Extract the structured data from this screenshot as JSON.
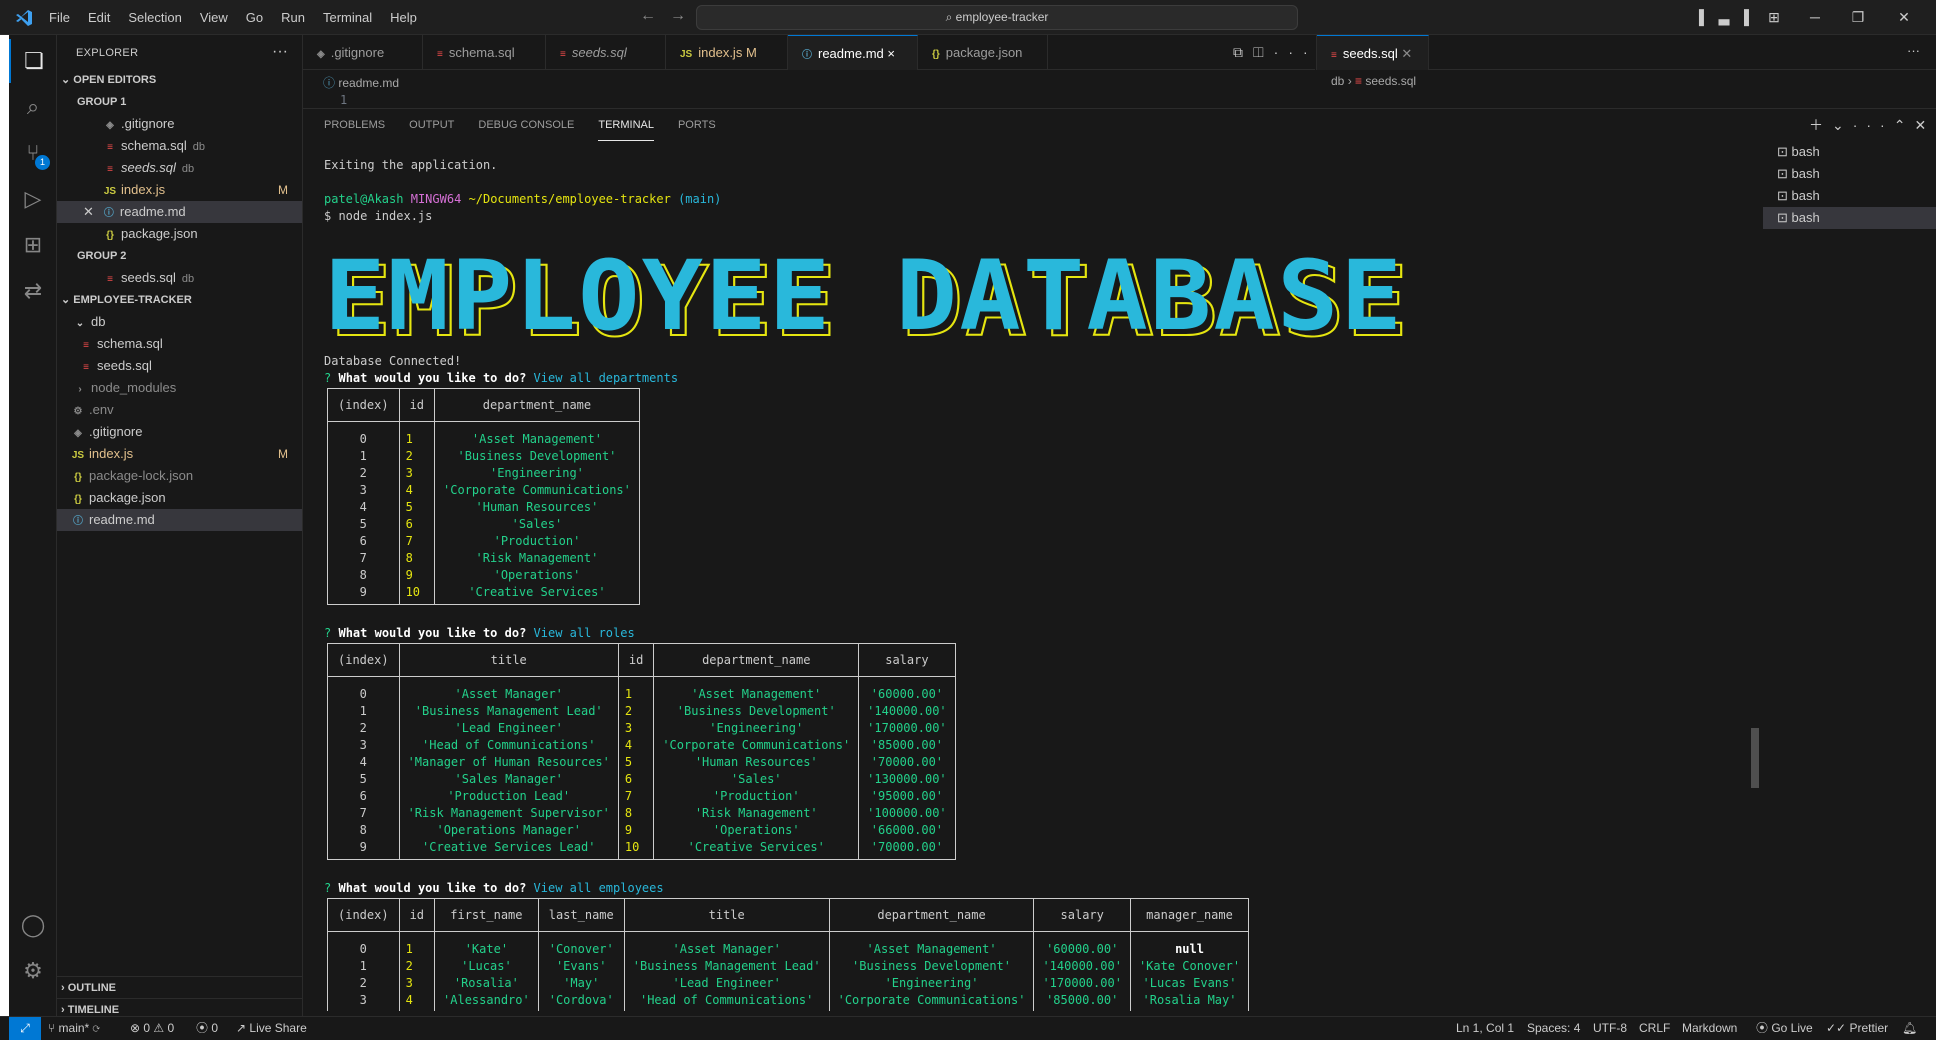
{
  "titlebar": {
    "menu": [
      "File",
      "Edit",
      "Selection",
      "View",
      "Go",
      "Run",
      "Terminal",
      "Help"
    ],
    "search": "employee-tracker"
  },
  "sidebar": {
    "title": "EXPLORER",
    "open_editors_label": "OPEN EDITORS",
    "group1_label": "GROUP 1",
    "group2_label": "GROUP 2",
    "group1": [
      {
        "icon": "git",
        "name": ".gitignore",
        "desc": "",
        "status": ""
      },
      {
        "icon": "sql",
        "name": "schema.sql",
        "desc": "db",
        "status": ""
      },
      {
        "icon": "sql",
        "name": "seeds.sql",
        "desc": "db",
        "status": ""
      },
      {
        "icon": "js",
        "name": "index.js",
        "desc": "",
        "status": "M"
      },
      {
        "icon": "info",
        "name": "readme.md",
        "desc": "",
        "status": ""
      },
      {
        "icon": "json",
        "name": "package.json",
        "desc": "",
        "status": ""
      }
    ],
    "group2": [
      {
        "icon": "sql",
        "name": "seeds.sql",
        "desc": "db"
      }
    ],
    "project_label": "EMPLOYEE-TRACKER",
    "tree": [
      {
        "icon": "folder",
        "name": "db",
        "status": ""
      },
      {
        "icon": "sql",
        "name": "schema.sql",
        "status": ""
      },
      {
        "icon": "sql",
        "name": "seeds.sql",
        "status": ""
      },
      {
        "icon": "folder-closed",
        "name": "node_modules",
        "status": ""
      },
      {
        "icon": "env",
        "name": ".env",
        "status": ""
      },
      {
        "icon": "git",
        "name": ".gitignore",
        "status": ""
      },
      {
        "icon": "js",
        "name": "index.js",
        "status": "M"
      },
      {
        "icon": "json",
        "name": "package-lock.json",
        "status": ""
      },
      {
        "icon": "json",
        "name": "package.json",
        "status": ""
      },
      {
        "icon": "info",
        "name": "readme.md",
        "status": ""
      }
    ],
    "outline_label": "OUTLINE",
    "timeline_label": "TIMELINE"
  },
  "tabs": [
    {
      "icon": "git",
      "label": ".gitignore",
      "italic": false,
      "status": ""
    },
    {
      "icon": "sql",
      "label": "schema.sql",
      "italic": false,
      "status": ""
    },
    {
      "icon": "sql",
      "label": "seeds.sql",
      "italic": true,
      "status": ""
    },
    {
      "icon": "js",
      "label": "index.js",
      "italic": false,
      "status": "M"
    },
    {
      "icon": "info",
      "label": "readme.md",
      "italic": false,
      "status": "×"
    },
    {
      "icon": "json",
      "label": "package.json",
      "italic": false,
      "status": ""
    }
  ],
  "editor": {
    "breadcrumb": "readme.md",
    "line1": "1"
  },
  "editor2": {
    "tab": "seeds.sql",
    "breadcrumb_folder": "db",
    "breadcrumb_file": "seeds.sql"
  },
  "panel": {
    "tabs": [
      "PROBLEMS",
      "OUTPUT",
      "DEBUG CONSOLE",
      "TERMINAL",
      "PORTS"
    ],
    "active_tab": "TERMINAL",
    "terminals": [
      "bash",
      "bash",
      "bash",
      "bash"
    ]
  },
  "terminal": {
    "exit_line": "Exiting the application.",
    "prompt_user": "patel@Akash",
    "prompt_env": "MINGW64",
    "prompt_path": "~/Documents/employee-tracker",
    "prompt_branch": "(main)",
    "command": "$ node index.js",
    "banner": "EMPLOYEE DATABASE",
    "connected": "Database Connected!",
    "q_mark": "?",
    "question": "What would you like to do?",
    "answer1": "View all departments",
    "answer2": "View all roles",
    "answer3": "View all employees",
    "departments": {
      "headers": [
        "(index)",
        "id",
        "department_name"
      ],
      "rows": [
        [
          "0",
          "1",
          "'Asset Management'"
        ],
        [
          "1",
          "2",
          "'Business Development'"
        ],
        [
          "2",
          "3",
          "'Engineering'"
        ],
        [
          "3",
          "4",
          "'Corporate Communications'"
        ],
        [
          "4",
          "5",
          "'Human Resources'"
        ],
        [
          "5",
          "6",
          "'Sales'"
        ],
        [
          "6",
          "7",
          "'Production'"
        ],
        [
          "7",
          "8",
          "'Risk Management'"
        ],
        [
          "8",
          "9",
          "'Operations'"
        ],
        [
          "9",
          "10",
          "'Creative Services'"
        ]
      ]
    },
    "roles": {
      "headers": [
        "(index)",
        "title",
        "id",
        "department_name",
        "salary"
      ],
      "rows": [
        [
          "0",
          "'Asset Manager'",
          "1",
          "'Asset Management'",
          "'60000.00'"
        ],
        [
          "1",
          "'Business Management Lead'",
          "2",
          "'Business Development'",
          "'140000.00'"
        ],
        [
          "2",
          "'Lead Engineer'",
          "3",
          "'Engineering'",
          "'170000.00'"
        ],
        [
          "3",
          "'Head of Communications'",
          "4",
          "'Corporate Communications'",
          "'85000.00'"
        ],
        [
          "4",
          "'Manager of Human Resources'",
          "5",
          "'Human Resources'",
          "'70000.00'"
        ],
        [
          "5",
          "'Sales Manager'",
          "6",
          "'Sales'",
          "'130000.00'"
        ],
        [
          "6",
          "'Production Lead'",
          "7",
          "'Production'",
          "'95000.00'"
        ],
        [
          "7",
          "'Risk Management Supervisor'",
          "8",
          "'Risk Management'",
          "'100000.00'"
        ],
        [
          "8",
          "'Operations Manager'",
          "9",
          "'Operations'",
          "'66000.00'"
        ],
        [
          "9",
          "'Creative Services Lead'",
          "10",
          "'Creative Services'",
          "'70000.00'"
        ]
      ]
    },
    "employees": {
      "headers": [
        "(index)",
        "id",
        "first_name",
        "last_name",
        "title",
        "department_name",
        "salary",
        "manager_name"
      ],
      "rows": [
        [
          "0",
          "1",
          "'Kate'",
          "'Conover'",
          "'Asset Manager'",
          "'Asset Management'",
          "'60000.00'",
          "null"
        ],
        [
          "1",
          "2",
          "'Lucas'",
          "'Evans'",
          "'Business Management Lead'",
          "'Business Development'",
          "'140000.00'",
          "'Kate Conover'"
        ],
        [
          "2",
          "3",
          "'Rosalia'",
          "'May'",
          "'Lead Engineer'",
          "'Engineering'",
          "'170000.00'",
          "'Lucas Evans'"
        ],
        [
          "3",
          "4",
          "'Alessandro'",
          "'Cordova'",
          "'Head of Communications'",
          "'Corporate Communications'",
          "'85000.00'",
          "'Rosalia May'"
        ]
      ]
    }
  },
  "status": {
    "branch": "main*",
    "errors": "0",
    "warnings": "0",
    "ports": "0",
    "live_share": "Live Share",
    "position": "Ln 1, Col 1",
    "spaces": "Spaces: 4",
    "encoding": "UTF-8",
    "eol": "CRLF",
    "language": "Markdown",
    "go_live": "Go Live",
    "prettier": "Prettier"
  },
  "colors": {
    "accent": "#0078d4",
    "banner": "#29b8db",
    "banner_shadow": "#e5e510",
    "string": "#23d18b",
    "number": "#e5e510"
  }
}
